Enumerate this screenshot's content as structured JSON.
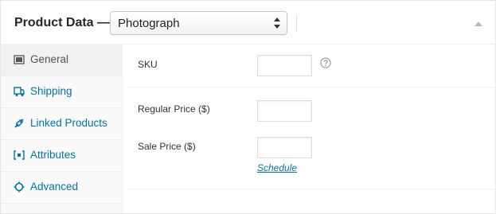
{
  "header": {
    "title": "Product Data —",
    "product_type": "Photograph"
  },
  "tabs": [
    {
      "label": "General",
      "icon": "general-icon",
      "active": true
    },
    {
      "label": "Shipping",
      "icon": "truck-icon",
      "active": false
    },
    {
      "label": "Linked Products",
      "icon": "link-icon",
      "active": false
    },
    {
      "label": "Attributes",
      "icon": "attributes-icon",
      "active": false
    },
    {
      "label": "Advanced",
      "icon": "gear-icon",
      "active": false
    }
  ],
  "general": {
    "sku_label": "SKU",
    "sku_value": "",
    "regular_price_label": "Regular Price ($)",
    "regular_price_value": "",
    "sale_price_label": "Sale Price ($)",
    "sale_price_value": "",
    "schedule_label": "Schedule"
  },
  "colors": {
    "link": "#0073aa",
    "active_tab_bg": "#f1f1f1",
    "border": "#eeeeee"
  }
}
